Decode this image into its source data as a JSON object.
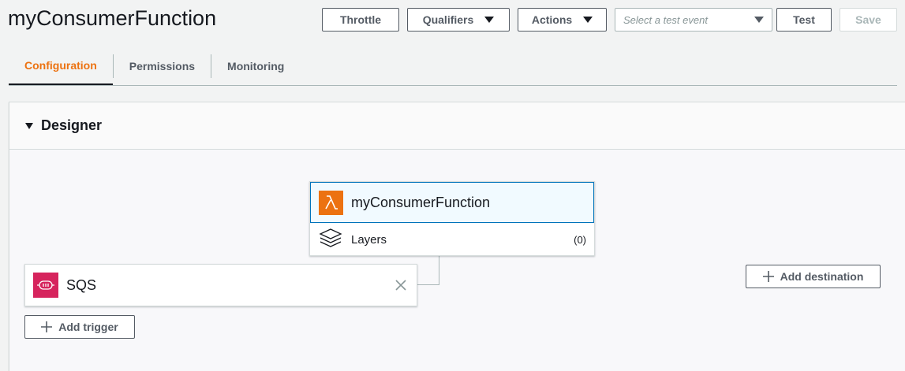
{
  "header": {
    "title": "myConsumerFunction",
    "throttle_label": "Throttle",
    "qualifiers_label": "Qualifiers",
    "actions_label": "Actions",
    "test_event_placeholder": "Select a test event",
    "test_label": "Test",
    "save_label": "Save"
  },
  "tabs": [
    {
      "label": "Configuration",
      "active": true
    },
    {
      "label": "Permissions",
      "active": false
    },
    {
      "label": "Monitoring",
      "active": false
    }
  ],
  "designer": {
    "title": "Designer",
    "function": {
      "name": "myConsumerFunction",
      "icon": "lambda-icon"
    },
    "layers": {
      "label": "Layers",
      "count": "(0)"
    },
    "trigger": {
      "name": "SQS",
      "icon": "sqs-icon"
    },
    "add_trigger_label": "Add trigger",
    "add_destination_label": "Add destination"
  },
  "colors": {
    "accent": "#ec7211",
    "selection": "#0073bb",
    "sqs": "#d6245d"
  }
}
